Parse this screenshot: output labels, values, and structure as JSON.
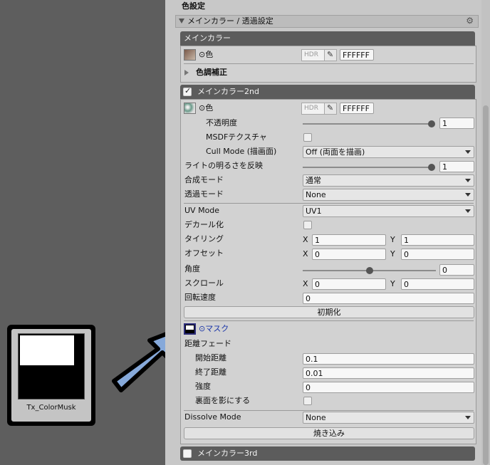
{
  "section_title": "色設定",
  "group": {
    "title": "メインカラー / 透過設定"
  },
  "main_color": {
    "header": "メインカラー",
    "color_label": "⊙色",
    "hdr": "HDR",
    "hex": "FFFFFF",
    "tone_label": "色調補正"
  },
  "main_color_2nd": {
    "header": "メインカラー2nd",
    "enabled": true,
    "color_label": "⊙色",
    "hdr": "HDR",
    "hex": "FFFFFF",
    "opacity": {
      "label": "不透明度",
      "value": "1",
      "fraction": 1.0
    },
    "msdf": {
      "label": "MSDFテクスチャ",
      "checked": false
    },
    "cull": {
      "label": "Cull Mode (描画面)",
      "value": "Off (両面を描画)"
    },
    "light": {
      "label": "ライトの明るさを反映",
      "value": "1",
      "fraction": 1.0
    },
    "blend": {
      "label": "合成モード",
      "value": "通常"
    },
    "alpha": {
      "label": "透過モード",
      "value": "None"
    },
    "uv": {
      "label": "UV Mode",
      "value": "UV1"
    },
    "decal": {
      "label": "デカール化",
      "checked": false
    },
    "tiling": {
      "label": "タイリング",
      "x_label": "X",
      "x": "1",
      "y_label": "Y",
      "y": "1"
    },
    "offset": {
      "label": "オフセット",
      "x_label": "X",
      "x": "0",
      "y_label": "Y",
      "y": "0"
    },
    "angle": {
      "label": "角度",
      "value": "0",
      "fraction": 0.5
    },
    "scroll": {
      "label": "スクロール",
      "x_label": "X",
      "x": "0",
      "y_label": "Y",
      "y": "0"
    },
    "rotation": {
      "label": "回転速度",
      "value": "0"
    },
    "reset_button": "初期化",
    "mask_label": "⊙マスク",
    "distance_fade": {
      "label": "距離フェード",
      "start": {
        "label": "開始距離",
        "value": "0.1"
      },
      "end": {
        "label": "終了距離",
        "value": "0.01"
      },
      "strength": {
        "label": "強度",
        "value": "0"
      },
      "backface": {
        "label": "裏面を影にする",
        "checked": false
      }
    },
    "dissolve": {
      "label": "Dissolve Mode",
      "value": "None"
    },
    "bake_button": "焼き込み"
  },
  "main_color_3rd": {
    "header": "メインカラー3rd",
    "enabled": false
  },
  "asset": {
    "name": "Tx_ColorMusk"
  }
}
